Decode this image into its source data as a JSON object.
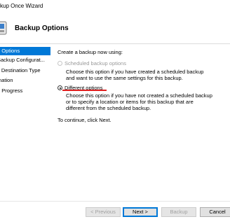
{
  "window": {
    "title": "kup Once Wizard"
  },
  "header": {
    "title": "Backup Options",
    "icon": "backup-wizard-icon"
  },
  "nav": {
    "items": [
      {
        "label": "e Options",
        "selected": true
      },
      {
        "label": "Backup Configurat...",
        "selected": false
      },
      {
        "label": "y Destination Type",
        "selected": false
      },
      {
        "label": "mation",
        "selected": false
      },
      {
        "label": "e Progress",
        "selected": false
      }
    ]
  },
  "main": {
    "prompt": "Create a backup now using:",
    "option_scheduled": {
      "label": "Scheduled backup options",
      "description_1": "Choose this option if you have created a scheduled backup",
      "description_2": "and want to use the same settings for this backup.",
      "enabled": false,
      "selected": false
    },
    "option_different": {
      "label": "Different options",
      "description_1": "Choose this option if you have not created a scheduled backup",
      "description_2": "or to specify a location or items for this backup that are",
      "description_3": "different from the scheduled backup.",
      "enabled": true,
      "selected": true
    },
    "continue_text": "To continue, click Next."
  },
  "buttons": {
    "previous": "< Previous",
    "next": "Next >",
    "backup": "Backup",
    "cancel": "Cancel"
  },
  "colors": {
    "selection": "#0078d7",
    "annotation_underline": "#e02020"
  }
}
